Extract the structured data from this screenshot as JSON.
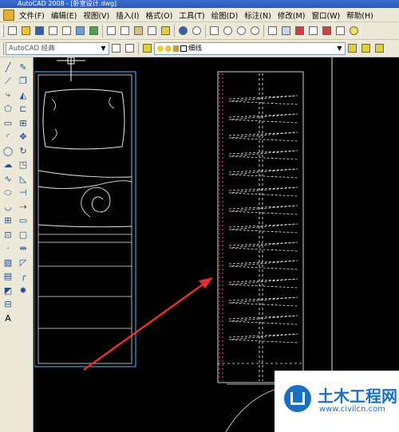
{
  "window": {
    "title": "AutoCAD 2008 - [卧室设计.dwg]"
  },
  "menus": [
    "文件(F)",
    "编辑(E)",
    "视图(V)",
    "插入(I)",
    "格式(O)",
    "工具(T)",
    "绘图(D)",
    "标注(N)",
    "修改(M)",
    "窗口(W)",
    "帮助(H)"
  ],
  "toolbar2": {
    "workspace": "AutoCAD 经典",
    "linetype": "细线"
  },
  "left_toolbar_col1": [
    "line-icon",
    "xline-icon",
    "polyline-icon",
    "polygon-icon",
    "rectangle-icon",
    "arc-icon",
    "circle-icon",
    "revcloud-icon",
    "spline-icon",
    "ellipse-icon",
    "ellipse-arc-icon",
    "insert-block-icon",
    "make-block-icon",
    "point-icon",
    "hatch-icon",
    "gradient-icon",
    "region-icon",
    "table-icon",
    "text-icon"
  ],
  "left_toolbar_col2": [
    "erase-icon",
    "copy-icon",
    "mirror-icon",
    "offset-icon",
    "array-icon",
    "move-icon",
    "rotate-icon",
    "scale-icon",
    "stretch-icon",
    "trim-icon",
    "extend-icon",
    "break-point-icon",
    "break-icon",
    "join-icon",
    "chamfer-icon",
    "fillet-icon",
    "explode-icon"
  ],
  "colors": {
    "cyan": "#3aa0e8",
    "magenta": "#c0307a",
    "arrow": "#e63030",
    "menubar": "#ece9d8"
  },
  "watermark": {
    "title": "土木工程网",
    "url": "www.civilcn.com"
  }
}
